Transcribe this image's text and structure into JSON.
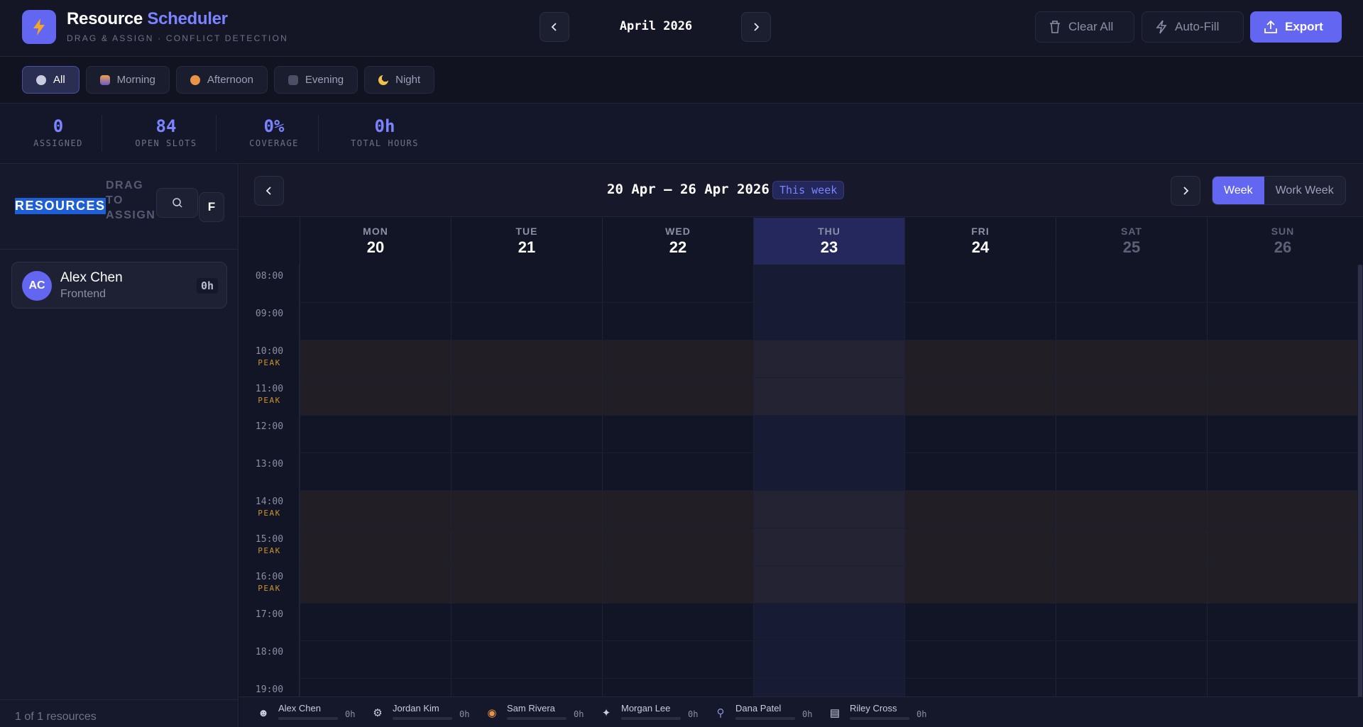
{
  "app": {
    "title_main": "Resource",
    "title_accent": "Scheduler",
    "subtitle": "DRAG & ASSIGN · CONFLICT DETECTION"
  },
  "header": {
    "month": "April 2026",
    "clear_label": "Clear All",
    "autofill_label": "Auto-Fill",
    "export_label": "Export"
  },
  "filters": [
    {
      "label": "All",
      "icon": "clock-icon",
      "color": "#c9cbe0",
      "active": true
    },
    {
      "label": "Morning",
      "icon": "sunrise-icon",
      "color": "#e8924a"
    },
    {
      "label": "Afternoon",
      "icon": "sun-icon",
      "color": "#e8924a"
    },
    {
      "label": "Evening",
      "icon": "city-night-icon",
      "color": "#6e7388"
    },
    {
      "label": "Night",
      "icon": "moon-icon",
      "color": "#f0c048"
    }
  ],
  "stats": [
    {
      "value": "0",
      "label": "ASSIGNED"
    },
    {
      "value": "84",
      "label": "OPEN SLOTS"
    },
    {
      "value": "0%",
      "label": "COVERAGE"
    },
    {
      "value": "0h",
      "label": "TOTAL HOURS"
    }
  ],
  "sidebar": {
    "title": "RESOURCES",
    "hint": "DRAG TO ASSIGN",
    "filter_button": "F",
    "resources": [
      {
        "initials": "AC",
        "name": "Alex Chen",
        "role": "Frontend",
        "hours": "0h"
      }
    ],
    "footer": "1 of 1 resources"
  },
  "calendar": {
    "range": "20 Apr – 26 Apr 2026",
    "badge": "This week",
    "views": [
      "Week",
      "Work Week"
    ],
    "days": [
      {
        "name": "MON",
        "date": "20"
      },
      {
        "name": "TUE",
        "date": "21"
      },
      {
        "name": "WED",
        "date": "22"
      },
      {
        "name": "THU",
        "date": "23"
      },
      {
        "name": "FRI",
        "date": "24"
      },
      {
        "name": "SAT",
        "date": "25"
      },
      {
        "name": "SUN",
        "date": "26"
      }
    ],
    "times": [
      {
        "time": "08:00",
        "peak": ""
      },
      {
        "time": "09:00",
        "peak": ""
      },
      {
        "time": "10:00",
        "peak": "PEAK"
      },
      {
        "time": "11:00",
        "peak": "PEAK"
      },
      {
        "time": "12:00",
        "peak": ""
      },
      {
        "time": "13:00",
        "peak": ""
      },
      {
        "time": "14:00",
        "peak": "PEAK"
      },
      {
        "time": "15:00",
        "peak": "PEAK"
      },
      {
        "time": "16:00",
        "peak": "PEAK"
      },
      {
        "time": "17:00",
        "peak": ""
      },
      {
        "time": "18:00",
        "peak": ""
      },
      {
        "time": "19:00",
        "peak": ""
      }
    ]
  },
  "footer_resources": [
    {
      "name": "Alex Chen",
      "hours": "0h",
      "icon": "person-icon"
    },
    {
      "name": "Jordan Kim",
      "hours": "0h",
      "icon": "gear-icon"
    },
    {
      "name": "Sam Rivera",
      "hours": "0h",
      "icon": "palette-icon"
    },
    {
      "name": "Morgan Lee",
      "hours": "0h",
      "icon": "wrench-icon"
    },
    {
      "name": "Dana Patel",
      "hours": "0h",
      "icon": "magnifier-icon"
    },
    {
      "name": "Riley Cross",
      "hours": "0h",
      "icon": "clipboard-icon"
    }
  ],
  "colors": {
    "accent": "#6366f1",
    "accent_text": "#7c83ff",
    "peak": "#c8922f",
    "today": "#25285c"
  }
}
